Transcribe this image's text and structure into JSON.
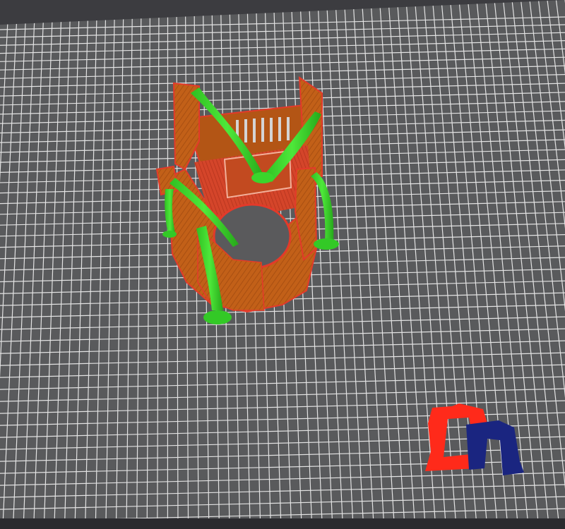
{
  "viewport": {
    "description_label": "",
    "bed_color": "#5e5e60",
    "grid_color": "#ffffff",
    "background_color": "#2b2b2f"
  },
  "model": {
    "wall_color": "#c7641d",
    "perimeter_color": "#e33a2a",
    "support_color": "#35d326"
  },
  "logo": {
    "name": "bed-logo-icon",
    "primary_color": "#ff2a1a",
    "secondary_color": "#1a2b8a"
  }
}
